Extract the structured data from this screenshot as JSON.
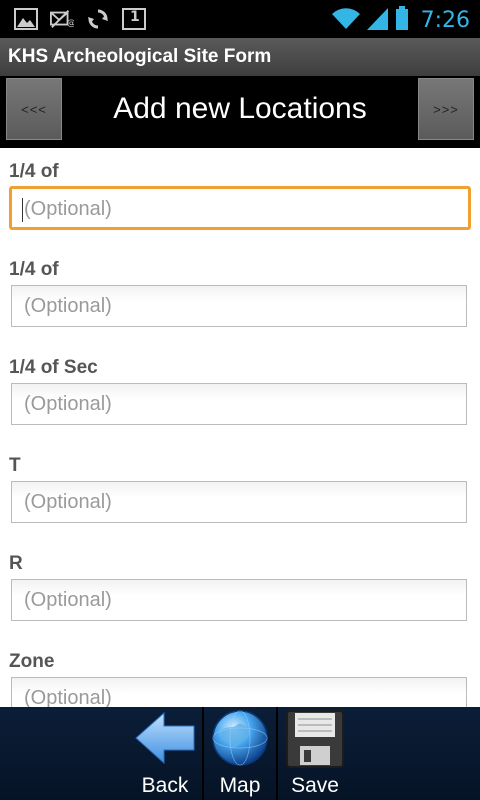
{
  "status_bar": {
    "time": "7:26",
    "notification_icons": [
      "gallery-icon",
      "mail-error-icon",
      "sync-icon",
      "calendar-icon"
    ],
    "calendar_day": "1",
    "system_icons": [
      "wifi-icon",
      "signal-icon",
      "battery-icon"
    ],
    "accent_color": "#33b5e5"
  },
  "app": {
    "title": "KHS Archeological Site Form"
  },
  "header": {
    "prev_label": "<<<",
    "title": "Add new Locations",
    "next_label": ">>>"
  },
  "form": {
    "fields": [
      {
        "label": "1/4 of",
        "placeholder": "(Optional)",
        "focused": true
      },
      {
        "label": "1/4 of",
        "placeholder": "(Optional)"
      },
      {
        "label": "1/4 of Sec",
        "placeholder": "(Optional)"
      },
      {
        "label": "T",
        "placeholder": "(Optional)"
      },
      {
        "label": "R",
        "placeholder": "(Optional)"
      },
      {
        "label": "Zone",
        "placeholder": "(Optional)"
      }
    ]
  },
  "toolbar": {
    "back_label": "Back",
    "map_label": "Map",
    "save_label": "Save"
  },
  "colors": {
    "focus_border": "#f0a030",
    "toolbar_bg": "#0b1e38"
  }
}
